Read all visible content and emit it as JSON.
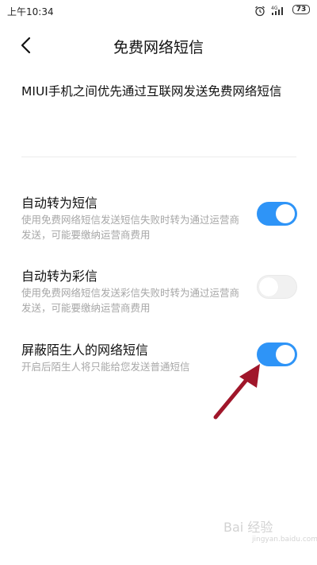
{
  "status_bar": {
    "time": "上午10:34",
    "network": "4G",
    "battery": "73",
    "icons": [
      "alarm-icon",
      "signal-icon",
      "battery-icon"
    ]
  },
  "header": {
    "back_icon": "back-arrow-icon",
    "title": "免费网络短信"
  },
  "description": "MIUI手机之间优先通过互联网发送免费网络短信",
  "settings": [
    {
      "title": "自动转为短信",
      "subtitle": "使用免费网络短信发送短信失败时转为通过运营商发送，可能要缴纳运营商费用",
      "enabled": true
    },
    {
      "title": "自动转为彩信",
      "subtitle": "使用免费网络短信发送彩信失败时转为通过运营商发送，可能要缴纳运营商费用",
      "enabled": false
    },
    {
      "title": "屏蔽陌生人的网络短信",
      "subtitle": "开启后陌生人将只能给您发送普通短信",
      "enabled": true
    }
  ],
  "colors": {
    "toggle_on": "#2e94f7",
    "toggle_off": "#f1f1f1",
    "annotation_arrow": "#a0162a"
  },
  "watermark": {
    "text": "Bai 经验",
    "sub": "jingyan.baidu.com"
  }
}
